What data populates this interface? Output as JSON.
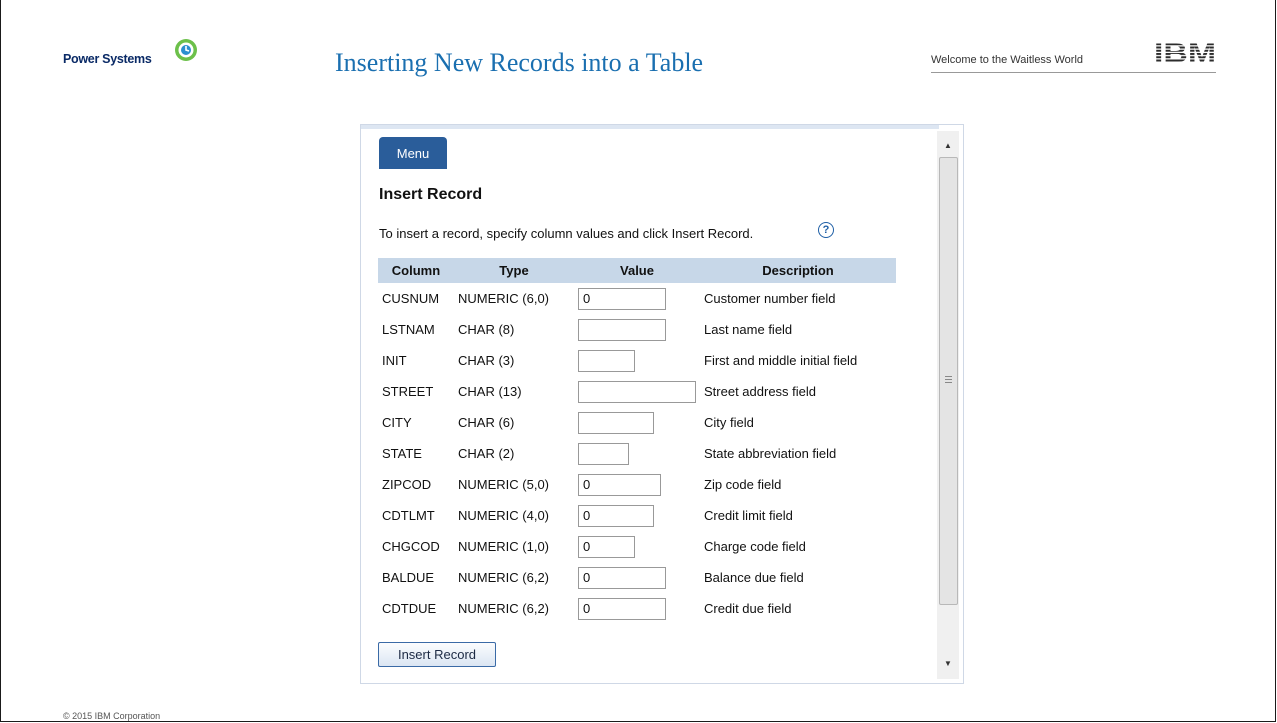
{
  "slide": {
    "brand": "Power Systems",
    "title": "Inserting New Records into a Table",
    "tagline": "Welcome to the Waitless World",
    "logo": "IBM",
    "copyright": "© 2015 IBM Corporation"
  },
  "app": {
    "menu_tab_label": "Menu",
    "heading": "Insert Record",
    "instructions": "To insert a record, specify column values and click Insert Record.",
    "help_icon": "?",
    "columns": [
      "Column",
      "Type",
      "Value",
      "Description"
    ],
    "rows": [
      {
        "column": "CUSNUM",
        "type": "NUMERIC (6,0)",
        "value": "0",
        "description": "Customer number field"
      },
      {
        "column": "LSTNAM",
        "type": "CHAR (8)",
        "value": "",
        "description": "Last name field"
      },
      {
        "column": "INIT",
        "type": "CHAR (3)",
        "value": "",
        "description": "First and middle initial field"
      },
      {
        "column": "STREET",
        "type": "CHAR (13)",
        "value": "",
        "description": "Street address field"
      },
      {
        "column": "CITY",
        "type": "CHAR (6)",
        "value": "",
        "description": "City field"
      },
      {
        "column": "STATE",
        "type": "CHAR (2)",
        "value": "",
        "description": "State abbreviation field"
      },
      {
        "column": "ZIPCOD",
        "type": "NUMERIC (5,0)",
        "value": "0",
        "description": "Zip code field"
      },
      {
        "column": "CDTLMT",
        "type": "NUMERIC (4,0)",
        "value": "0",
        "description": "Credit limit field"
      },
      {
        "column": "CHGCOD",
        "type": "NUMERIC (1,0)",
        "value": "0",
        "description": "Charge code field"
      },
      {
        "column": "BALDUE",
        "type": "NUMERIC (6,2)",
        "value": "0",
        "description": "Balance due field"
      },
      {
        "column": "CDTDUE",
        "type": "NUMERIC (6,2)",
        "value": "0",
        "description": "Credit due field"
      }
    ],
    "insert_button_label": "Insert Record"
  },
  "colors": {
    "title_blue": "#1a6fb0",
    "menu_tab": "#2a5d9a",
    "table_header": "#c7d7e8"
  }
}
